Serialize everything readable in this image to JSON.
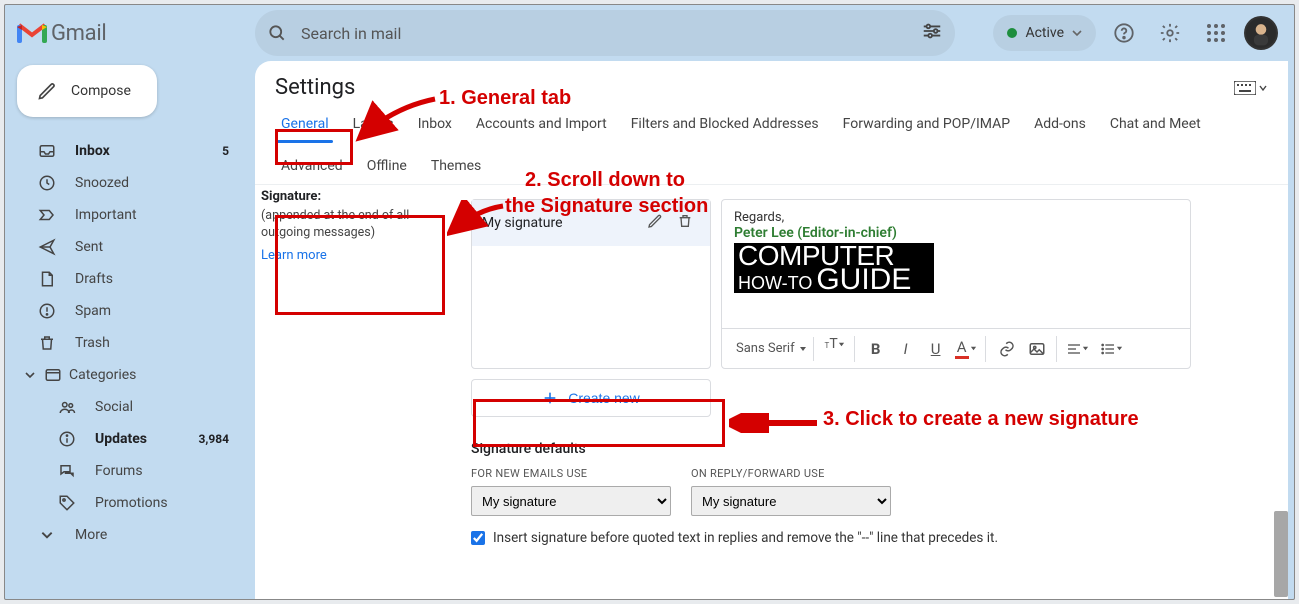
{
  "app_name": "Gmail",
  "search": {
    "placeholder": "Search in mail"
  },
  "status": {
    "label": "Active"
  },
  "compose_label": "Compose",
  "nav": [
    {
      "icon": "inbox",
      "label": "Inbox",
      "count": "5",
      "strong": true
    },
    {
      "icon": "clock",
      "label": "Snoozed"
    },
    {
      "icon": "important",
      "label": "Important"
    },
    {
      "icon": "send",
      "label": "Sent"
    },
    {
      "icon": "file",
      "label": "Drafts"
    },
    {
      "icon": "spam",
      "label": "Spam"
    },
    {
      "icon": "trash",
      "label": "Trash"
    }
  ],
  "categories_label": "Categories",
  "category_items": [
    {
      "icon": "people",
      "label": "Social"
    },
    {
      "icon": "info",
      "label": "Updates",
      "count": "3,984",
      "strong": true
    },
    {
      "icon": "forums",
      "label": "Forums"
    },
    {
      "icon": "tag",
      "label": "Promotions"
    }
  ],
  "more_label": "More",
  "settings_title": "Settings",
  "tabs": [
    "General",
    "Labels",
    "Inbox",
    "Accounts and Import",
    "Filters and Blocked Addresses",
    "Forwarding and POP/IMAP",
    "Add-ons",
    "Chat and Meet",
    "Advanced",
    "Offline",
    "Themes"
  ],
  "active_tab": "General",
  "signature": {
    "heading": "Signature:",
    "desc": "(appended at the end of all outgoing messages)",
    "learn": "Learn more",
    "selected_name": "My signature",
    "editor": {
      "line1": "Regards,",
      "line2": "Peter Lee (Editor-in-chief)",
      "logo_top": "COMPUTER",
      "logo_bottom_a": "HOW-TO",
      "logo_bottom_b": "GUIDE",
      "font_family": "Sans Serif"
    },
    "create_label": "Create new"
  },
  "defaults": {
    "title": "Signature defaults",
    "new_label": "FOR NEW EMAILS USE",
    "reply_label": "ON REPLY/FORWARD USE",
    "new_value": "My signature",
    "reply_value": "My signature",
    "checkbox_label": "Insert signature before quoted text in replies and remove the \"--\" line that precedes it."
  },
  "annotations": {
    "a1": "1. General tab",
    "a2a": "2. Scroll down to",
    "a2b": "the Signature section",
    "a3": "3. Click to create a new signature"
  }
}
